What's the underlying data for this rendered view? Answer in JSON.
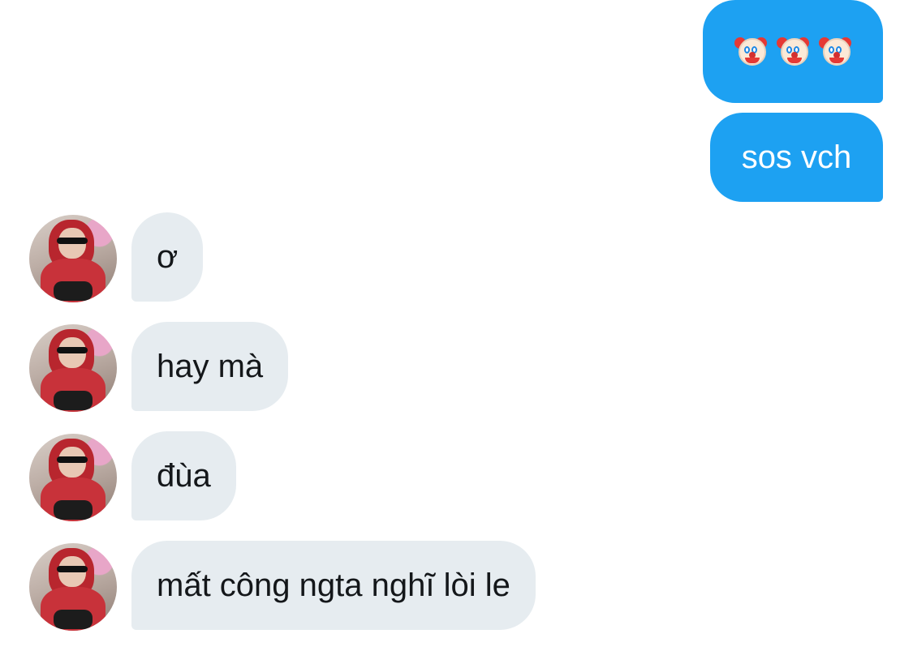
{
  "conversation": {
    "sent": [
      {
        "kind": "emoji",
        "icons": [
          "clown-face-icon",
          "clown-face-icon",
          "clown-face-icon"
        ]
      },
      {
        "kind": "text",
        "text": "sos vch"
      }
    ],
    "received": [
      {
        "text": "ơ"
      },
      {
        "text": "hay mà"
      },
      {
        "text": "đùa"
      },
      {
        "text": "mất công ngta nghĩ lòi le"
      }
    ]
  },
  "colors": {
    "sent_bubble": "#1da1f2",
    "received_bubble": "#e6ecf0",
    "background": "#ffffff"
  }
}
